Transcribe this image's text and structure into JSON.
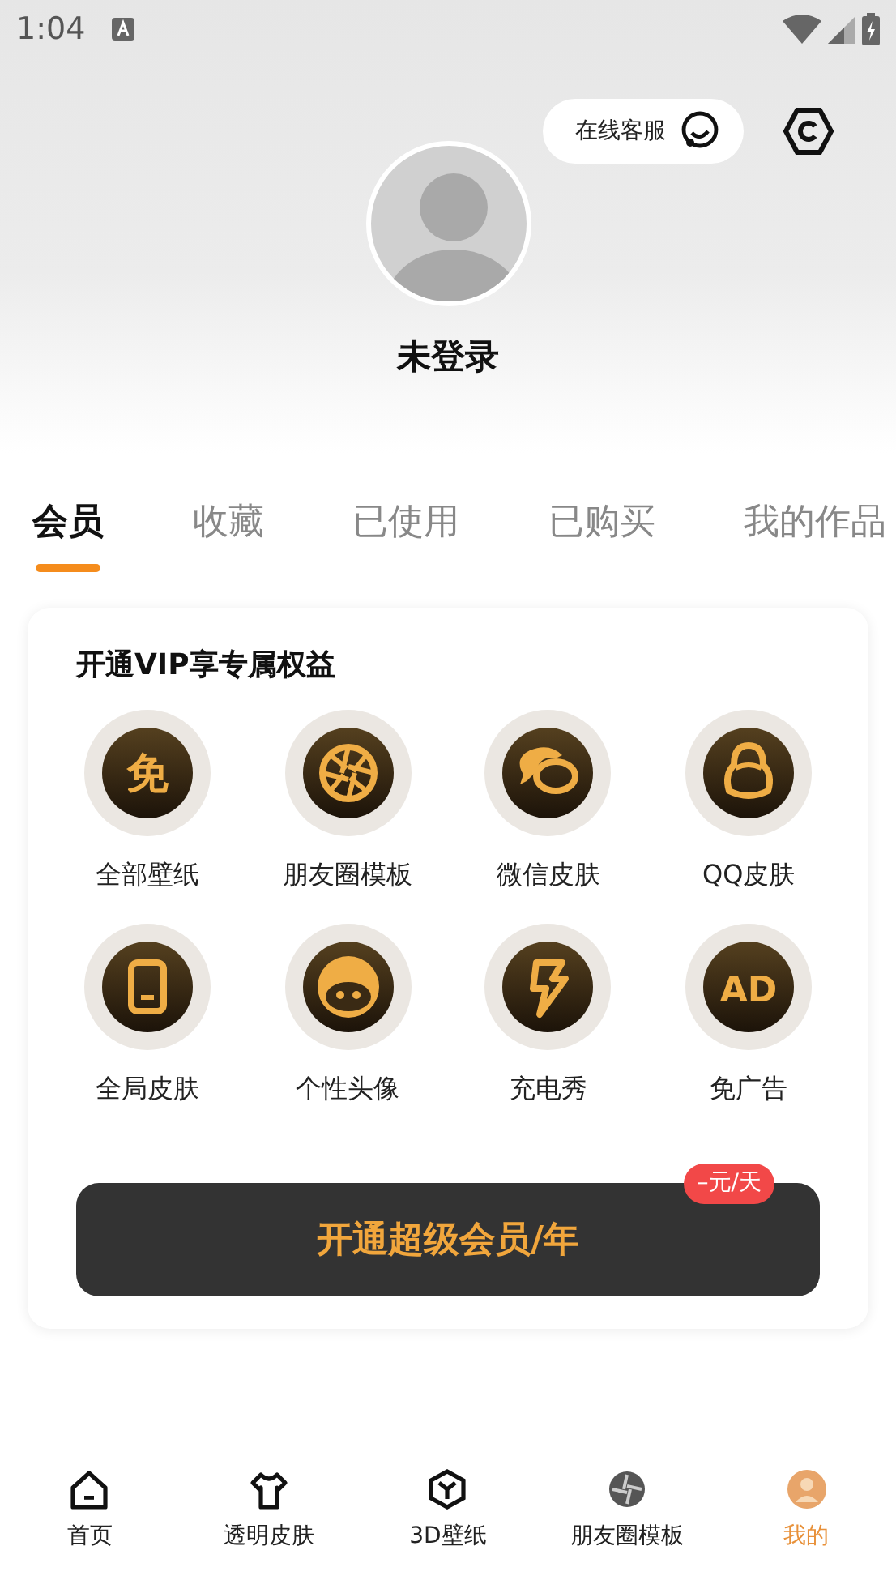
{
  "status_bar": {
    "time": "1:04"
  },
  "header": {
    "service_button": "在线客服",
    "username": "未登录"
  },
  "tabs": [
    {
      "label": "会员",
      "selected": true
    },
    {
      "label": "收藏",
      "selected": false
    },
    {
      "label": "已使用",
      "selected": false
    },
    {
      "label": "已购买",
      "selected": false
    },
    {
      "label": "我的作品",
      "selected": false
    }
  ],
  "vip_card": {
    "title": "开通VIP享专属权益",
    "benefits": [
      {
        "label": "全部壁纸",
        "kind": "glyph",
        "glyph": "免"
      },
      {
        "label": "朋友圈模板",
        "kind": "aperture"
      },
      {
        "label": "微信皮肤",
        "kind": "chat"
      },
      {
        "label": "QQ皮肤",
        "kind": "penguin"
      },
      {
        "label": "全局皮肤",
        "kind": "phone"
      },
      {
        "label": "个性头像",
        "kind": "face"
      },
      {
        "label": "充电秀",
        "kind": "bolt"
      },
      {
        "label": "免广告",
        "kind": "glyph",
        "glyph": "AD"
      }
    ],
    "button": "开通超级会员/年",
    "badge": "–元/天"
  },
  "bottom_nav": [
    {
      "label": "首页",
      "kind": "home",
      "selected": false
    },
    {
      "label": "透明皮肤",
      "kind": "shirt",
      "selected": false
    },
    {
      "label": "3D壁纸",
      "kind": "cube",
      "selected": false
    },
    {
      "label": "朋友圈模板",
      "kind": "aperture",
      "selected": false
    },
    {
      "label": "我的",
      "kind": "avatar",
      "selected": true
    }
  ]
}
